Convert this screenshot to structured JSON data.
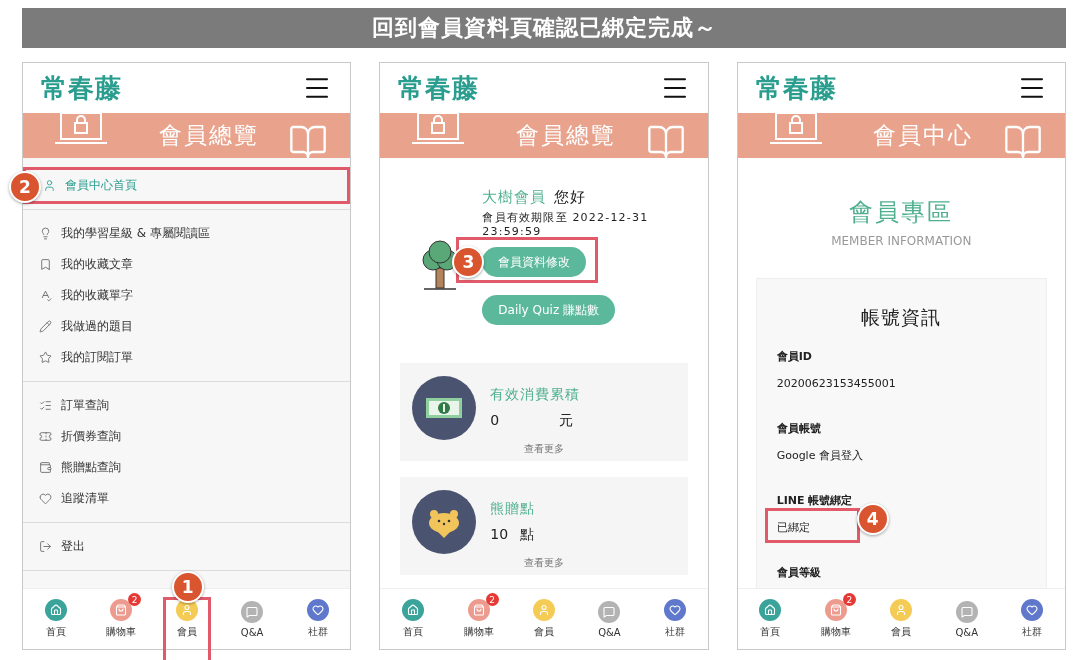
{
  "title": "回到會員資料頁確認已綁定完成～",
  "phones": [
    {
      "kind": "menu",
      "logo": "常春藤",
      "banner_title": "會員總覽",
      "menu_groups": [
        [
          {
            "label": "會員中心首頁",
            "selected": true,
            "callout": "2"
          }
        ],
        [
          {
            "label": "我的學習星級 & 專屬閱讀區",
            "selected": false
          },
          {
            "label": "我的收藏文章",
            "selected": false
          },
          {
            "label": "我的收藏單字",
            "selected": false
          },
          {
            "label": "我做過的題目",
            "selected": false
          },
          {
            "label": "我的訂閱訂單",
            "selected": false
          }
        ],
        [
          {
            "label": "訂單查詢",
            "selected": false
          },
          {
            "label": "折價券查詢",
            "selected": false
          },
          {
            "label": "熊贈點查詢",
            "selected": false
          },
          {
            "label": "追蹤清單",
            "selected": false
          }
        ],
        [
          {
            "label": "登出",
            "selected": false
          }
        ]
      ],
      "nav": [
        {
          "label": "首頁",
          "color": "#3aa39a"
        },
        {
          "label": "購物車",
          "color": "#ee9b8f",
          "badge": "2"
        },
        {
          "label": "會員",
          "color": "#f4cb55",
          "callout": "1"
        },
        {
          "label": "Q&A",
          "color": "#b3b3b3"
        },
        {
          "label": "社群",
          "color": "#5f78cc"
        }
      ]
    },
    {
      "kind": "overview",
      "logo": "常春藤",
      "banner_title": "會員總覽",
      "member_level": "大樹會員",
      "greeting": "您好",
      "expiry": "會員有效期限至 2022-12-31 23:59:59",
      "buttons": [
        {
          "label": "會員資料修改",
          "callout": "3"
        },
        {
          "label": "Daily Quiz 賺點數"
        }
      ],
      "cards": [
        {
          "title": "有效消費累積",
          "value": "0",
          "unit": "元",
          "more": "查看更多"
        },
        {
          "title": "熊贈點",
          "value": "10",
          "unit": "點",
          "more": "查看更多"
        }
      ],
      "nav": [
        {
          "label": "首頁",
          "color": "#3aa39a"
        },
        {
          "label": "購物車",
          "color": "#ee9b8f",
          "badge": "2"
        },
        {
          "label": "會員",
          "color": "#f4cb55"
        },
        {
          "label": "Q&A",
          "color": "#b3b3b3"
        },
        {
          "label": "社群",
          "color": "#5f78cc"
        }
      ]
    },
    {
      "kind": "profile",
      "logo": "常春藤",
      "banner_title": "會員中心",
      "heading": "會員專區",
      "subheading": "MEMBER INFORMATION",
      "card_title": "帳號資訊",
      "fields": [
        {
          "label": "會員ID",
          "value": "20200623153455001"
        },
        {
          "label": "會員帳號",
          "value": "Google 會員登入"
        },
        {
          "label": "LINE 帳號綁定",
          "value": "已綁定",
          "callout": "4"
        },
        {
          "label": "會員等級"
        }
      ],
      "nav": [
        {
          "label": "首頁",
          "color": "#3aa39a"
        },
        {
          "label": "購物車",
          "color": "#ee9b8f",
          "badge": "2"
        },
        {
          "label": "會員",
          "color": "#f4cb55"
        },
        {
          "label": "Q&A",
          "color": "#b3b3b3"
        },
        {
          "label": "社群",
          "color": "#5f78cc"
        }
      ]
    }
  ]
}
